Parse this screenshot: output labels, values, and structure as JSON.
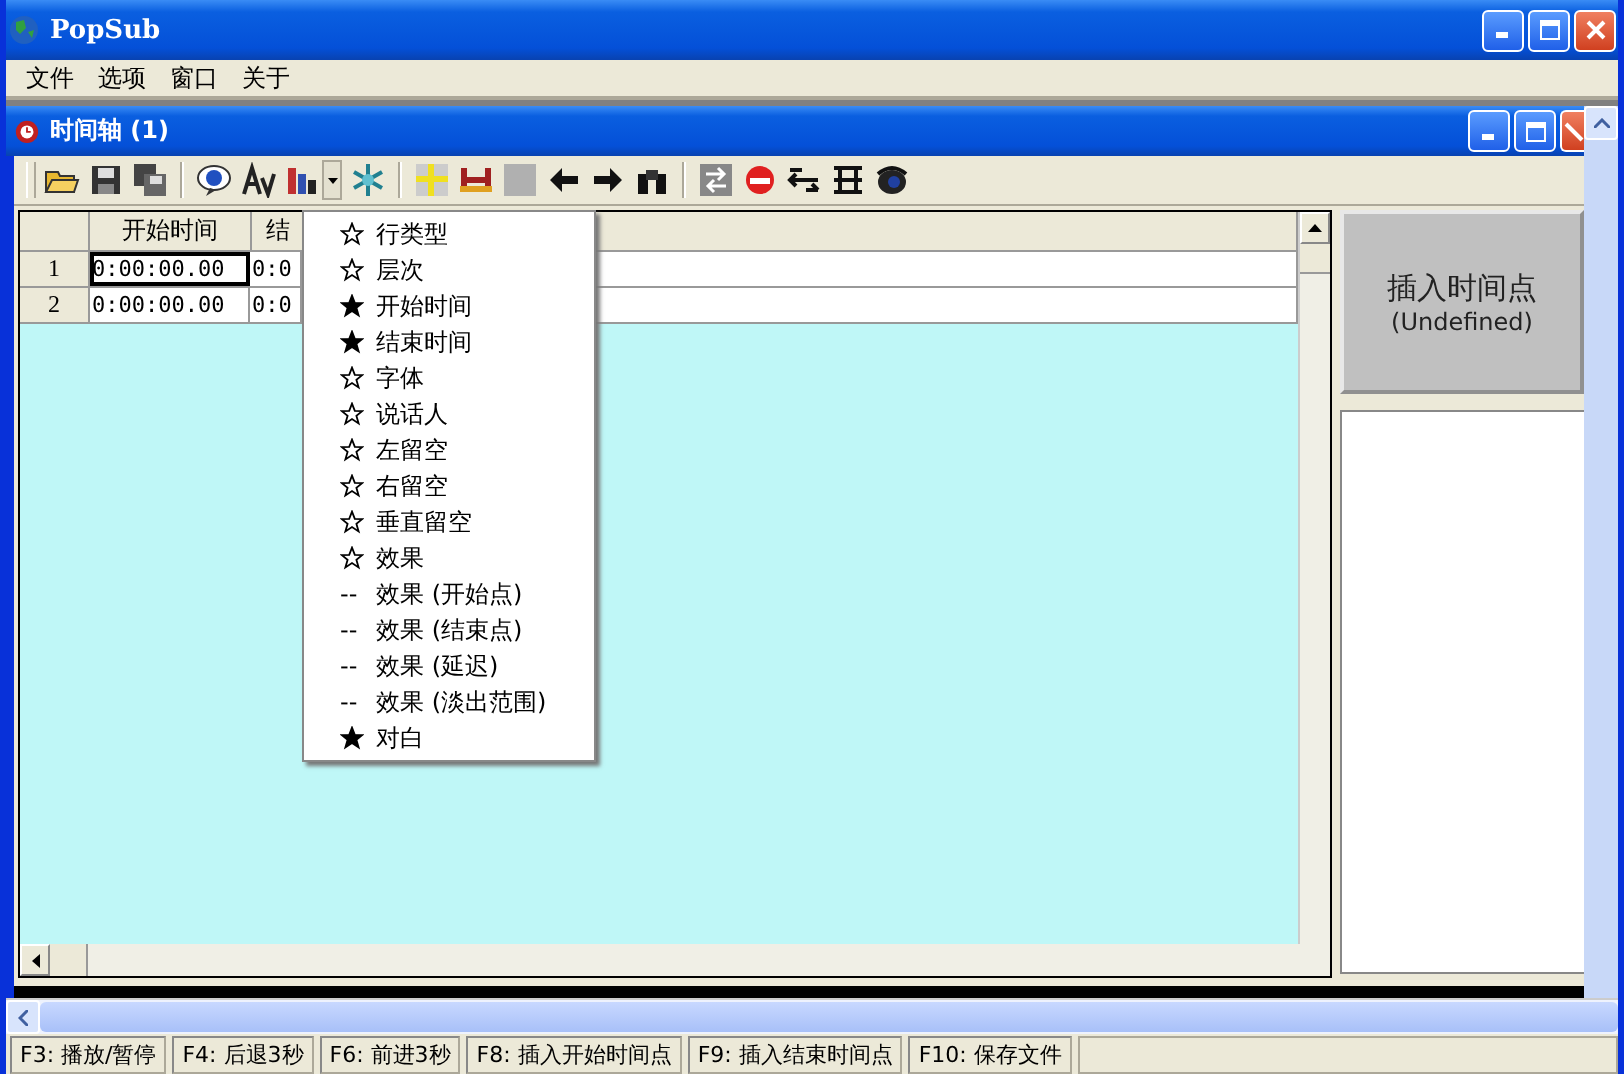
{
  "window": {
    "title": "PopSub"
  },
  "menu_bar": [
    "文件",
    "选项",
    "窗口",
    "关于"
  ],
  "child_window": {
    "title": "时间轴 (1)"
  },
  "grid": {
    "columns": [
      "开始时间",
      "结"
    ],
    "rows": [
      {
        "number": "1",
        "cells": [
          "0:00:00.00",
          "0:0"
        ],
        "focused": true
      },
      {
        "number": "2",
        "cells": [
          "0:00:00.00",
          "0:0"
        ],
        "focused": false
      }
    ]
  },
  "column_menu": [
    {
      "kind": "option",
      "label": "行类型",
      "checked": false
    },
    {
      "kind": "option",
      "label": "层次",
      "checked": false
    },
    {
      "kind": "option",
      "label": "开始时间",
      "checked": true
    },
    {
      "kind": "option",
      "label": "结束时间",
      "checked": true
    },
    {
      "kind": "option",
      "label": "字体",
      "checked": false
    },
    {
      "kind": "option",
      "label": "说话人",
      "checked": false
    },
    {
      "kind": "option",
      "label": "左留空",
      "checked": false
    },
    {
      "kind": "option",
      "label": "右留空",
      "checked": false
    },
    {
      "kind": "option",
      "label": "垂直留空",
      "checked": false
    },
    {
      "kind": "option",
      "label": "效果",
      "checked": false
    },
    {
      "kind": "sub",
      "prefix": "--",
      "label": "效果 (开始点)"
    },
    {
      "kind": "sub",
      "prefix": "--",
      "label": "效果 (结束点)"
    },
    {
      "kind": "sub",
      "prefix": "--",
      "label": "效果 (延迟)"
    },
    {
      "kind": "sub",
      "prefix": "--",
      "label": "效果 (淡出范围)"
    },
    {
      "kind": "option",
      "label": "对白",
      "checked": true
    }
  ],
  "insert_button": {
    "label": "插入时间点",
    "sublabel": "(Undefined)"
  },
  "status_bar": [
    "F3: 播放/暂停",
    "F4: 后退3秒",
    "F6: 前进3秒",
    "F8: 插入开始时间点",
    "F9: 插入结束时间点",
    "F10: 保存文件"
  ]
}
